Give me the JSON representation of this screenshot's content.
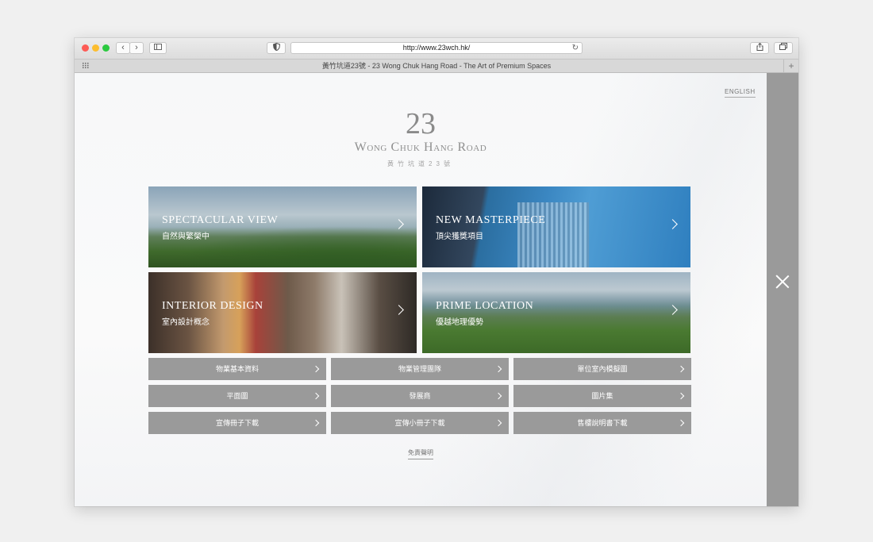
{
  "browser": {
    "url": "http://www.23wch.hk/",
    "tab_title": "黃竹坑道23號 - 23 Wong Chuk Hang Road - The Art of Premium Spaces",
    "reload_icon": "↻",
    "plus_icon": "+",
    "colors": {
      "close": "#fd5b55",
      "minimize": "#fcbd2f",
      "zoom": "#2bc93f"
    }
  },
  "page": {
    "language_link": "ENGLISH",
    "logo": {
      "number": "23",
      "name": "Wong Chuk Hang Road",
      "chinese": "黃竹坑道23號"
    },
    "tiles": [
      {
        "en": "SPECTACULAR VIEW",
        "zh": "自然與繁榮中"
      },
      {
        "en": "NEW MASTERPIECE",
        "zh": "頂尖獲獎項目"
      },
      {
        "en": "INTERIOR DESIGN",
        "zh": "室內設計概念"
      },
      {
        "en": "PRIME LOCATION",
        "zh": "優越地理優勢"
      }
    ],
    "buttons": [
      "物業基本資料",
      "物業管理團隊",
      "單位室內模擬圖",
      "平面圖",
      "發展商",
      "圖片集",
      "宣傳冊子下載",
      "宣傳小冊子下載",
      "售樓說明書下載"
    ],
    "disclaimer": "免責聲明"
  }
}
